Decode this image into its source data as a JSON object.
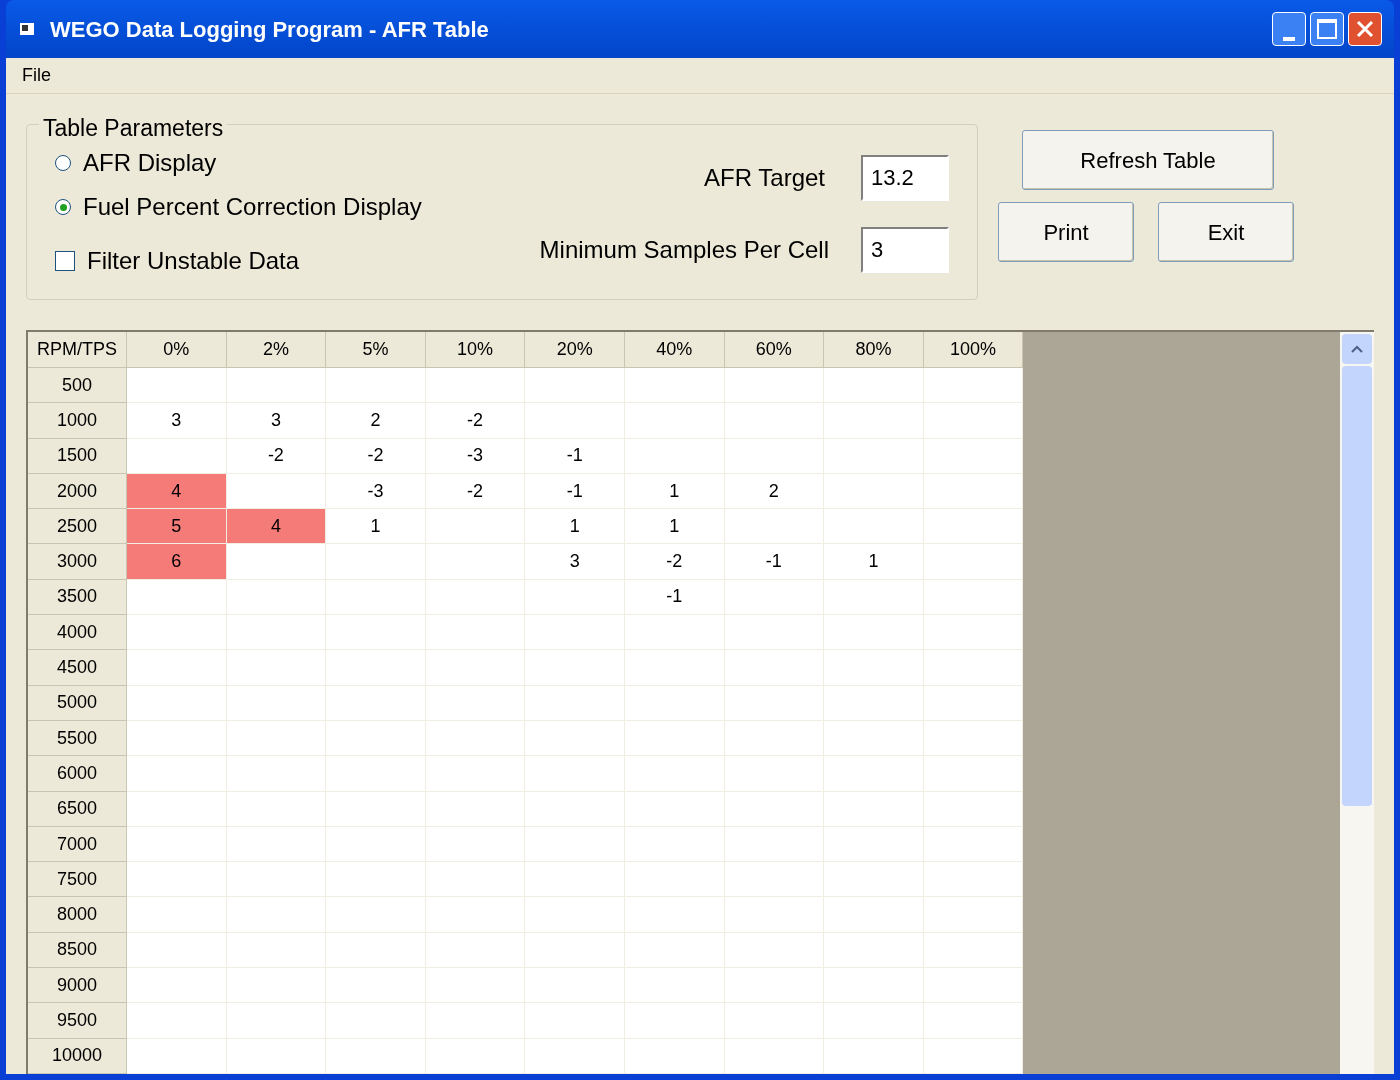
{
  "window": {
    "title": "WEGO Data Logging Program - AFR Table"
  },
  "menu": [
    "File"
  ],
  "parameters": {
    "title": "Table Parameters",
    "display_options": [
      {
        "label": "AFR Display",
        "selected": false
      },
      {
        "label": "Fuel Percent Correction Display",
        "selected": true
      }
    ],
    "filter": {
      "label": "Filter Unstable Data",
      "checked": false
    },
    "afr_target": {
      "label": "AFR Target",
      "value": "13.2"
    },
    "min_samples": {
      "label": "Minimum Samples Per Cell",
      "value": "3"
    }
  },
  "buttons": {
    "refresh": "Refresh Table",
    "print": "Print",
    "exit": "Exit"
  },
  "table": {
    "corner": "RPM/TPS",
    "columns": [
      "0%",
      "2%",
      "5%",
      "10%",
      "20%",
      "40%",
      "60%",
      "80%",
      "100%"
    ],
    "rows": [
      {
        "rpm": "500",
        "cells": [
          {
            "flagged": false
          },
          {
            "flagged": false
          },
          {
            "flagged": false
          },
          {
            "flagged": false
          },
          {
            "flagged": false
          },
          {
            "flagged": false
          },
          {
            "flagged": false
          },
          {
            "flagged": false
          },
          {
            "flagged": false
          }
        ]
      },
      {
        "rpm": "1000",
        "cells": [
          {
            "value": "3",
            "flagged": false
          },
          {
            "value": "3",
            "flagged": false
          },
          {
            "value": "2",
            "flagged": false
          },
          {
            "value": "-2",
            "flagged": false
          },
          {
            "flagged": false
          },
          {
            "flagged": false
          },
          {
            "flagged": false
          },
          {
            "flagged": false
          },
          {
            "flagged": false
          }
        ]
      },
      {
        "rpm": "1500",
        "cells": [
          {
            "flagged": false
          },
          {
            "value": "-2",
            "flagged": false
          },
          {
            "value": "-2",
            "flagged": false
          },
          {
            "value": "-3",
            "flagged": false
          },
          {
            "value": "-1",
            "flagged": false
          },
          {
            "flagged": false
          },
          {
            "flagged": false
          },
          {
            "flagged": false
          },
          {
            "flagged": false
          }
        ]
      },
      {
        "rpm": "2000",
        "cells": [
          {
            "value": "4",
            "flagged": true
          },
          {
            "flagged": false
          },
          {
            "value": "-3",
            "flagged": false
          },
          {
            "value": "-2",
            "flagged": false
          },
          {
            "value": "-1",
            "flagged": false
          },
          {
            "value": "1",
            "flagged": false
          },
          {
            "value": "2",
            "flagged": false
          },
          {
            "flagged": false
          },
          {
            "flagged": false
          }
        ]
      },
      {
        "rpm": "2500",
        "cells": [
          {
            "value": "5",
            "flagged": true
          },
          {
            "value": "4",
            "flagged": true
          },
          {
            "value": "1",
            "flagged": false
          },
          {
            "flagged": false
          },
          {
            "value": "1",
            "flagged": false
          },
          {
            "value": "1",
            "flagged": false
          },
          {
            "flagged": false
          },
          {
            "flagged": false
          },
          {
            "flagged": false
          }
        ]
      },
      {
        "rpm": "3000",
        "cells": [
          {
            "value": "6",
            "flagged": true
          },
          {
            "flagged": false
          },
          {
            "flagged": false
          },
          {
            "flagged": false
          },
          {
            "value": "3",
            "flagged": false
          },
          {
            "value": "-2",
            "flagged": false
          },
          {
            "value": "-1",
            "flagged": false
          },
          {
            "value": "1",
            "flagged": false
          },
          {
            "flagged": false
          }
        ]
      },
      {
        "rpm": "3500",
        "cells": [
          {
            "flagged": false
          },
          {
            "flagged": false
          },
          {
            "flagged": false
          },
          {
            "flagged": false
          },
          {
            "flagged": false
          },
          {
            "value": "-1",
            "flagged": false
          },
          {
            "flagged": false
          },
          {
            "flagged": false
          },
          {
            "flagged": false
          }
        ]
      },
      {
        "rpm": "4000",
        "cells": []
      },
      {
        "rpm": "4500",
        "cells": []
      },
      {
        "rpm": "5000",
        "cells": []
      },
      {
        "rpm": "5500",
        "cells": []
      },
      {
        "rpm": "6000",
        "cells": []
      },
      {
        "rpm": "6500",
        "cells": []
      },
      {
        "rpm": "7000",
        "cells": []
      },
      {
        "rpm": "7500",
        "cells": []
      },
      {
        "rpm": "8000",
        "cells": []
      },
      {
        "rpm": "8500",
        "cells": []
      },
      {
        "rpm": "9000",
        "cells": []
      },
      {
        "rpm": "9500",
        "cells": []
      },
      {
        "rpm": "10000",
        "cells": []
      }
    ]
  }
}
